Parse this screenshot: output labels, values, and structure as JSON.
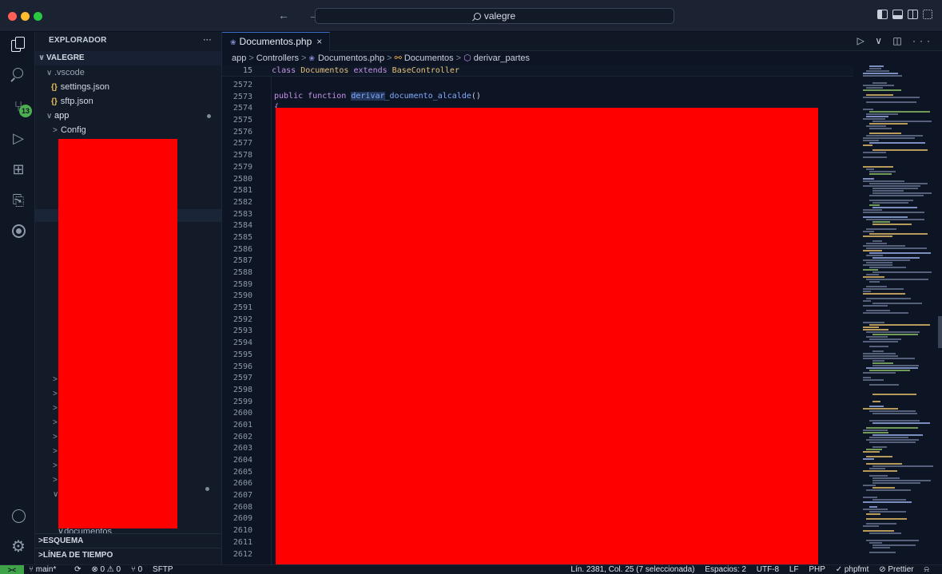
{
  "window": {
    "search_text": "valegre",
    "nav_arrows": "← →"
  },
  "activity_bar": {
    "scm_badge": "13"
  },
  "sidebar": {
    "title": "EXPLORADOR",
    "more": "···",
    "root": "VALEGRE",
    "items": [
      {
        "label": ".vscode",
        "chevron": "∨"
      },
      {
        "label": "settings.json",
        "icon": "{}"
      },
      {
        "label": "sftp.json",
        "icon": "{}"
      },
      {
        "label": "app",
        "chevron": "∨"
      },
      {
        "label": "Config",
        "chevron": ">"
      }
    ],
    "partial_item": "documentos",
    "sections": [
      "ESQUEMA",
      "LÍNEA DE TIEMPO"
    ]
  },
  "editor": {
    "tab": {
      "icon": "php",
      "label": "Documentos.php",
      "close": "×"
    },
    "actions": "▷ ∨  ◫  ···",
    "breadcrumb": {
      "parts": [
        "app",
        "Controllers",
        "Documentos.php",
        "Documentos",
        "derivar_partes"
      ]
    },
    "sticky": {
      "line": "15",
      "kw": "class",
      "cls": "Documentos",
      "kw2": "extends",
      "base": "BaseController"
    },
    "line_numbers": [
      "2572",
      "2573",
      "2574",
      "2575",
      "2576",
      "2577",
      "2578",
      "2579",
      "2580",
      "2581",
      "2582",
      "2583",
      "2584",
      "2585",
      "2586",
      "2587",
      "2588",
      "2589",
      "2590",
      "2591",
      "2592",
      "2593",
      "2594",
      "2595",
      "2596",
      "2597",
      "2598",
      "2599",
      "2600",
      "2601",
      "2602",
      "2603",
      "2604",
      "2605",
      "2606",
      "2607",
      "2608",
      "2609",
      "2610",
      "2611",
      "2612"
    ],
    "code": {
      "kw_public": "public",
      "kw_function": "function",
      "fn_name_selected": "derivar",
      "fn_name_rest": "_documento_alcalde",
      "parens": "()",
      "brace": "{"
    }
  },
  "statusbar": {
    "remote": "><",
    "branch": "main*",
    "sync": "⟳",
    "problems": "⊗ 0 ⚠ 0",
    "ports": "⑂ 0",
    "sftp": "SFTP",
    "position": "Lín. 2381, Col. 25 (7 seleccionada)",
    "spaces": "Espacios: 2",
    "encoding": "UTF-8",
    "eol": "LF",
    "language": "PHP",
    "phpfmt": "✓ phpfmt",
    "prettier": "⊘ Prettier",
    "bell": "🔔"
  },
  "colors": {
    "redaction": "#ff0000",
    "accent": "#3a6fc4",
    "scm_badge": "#4caf50",
    "remote": "#3fa348"
  }
}
